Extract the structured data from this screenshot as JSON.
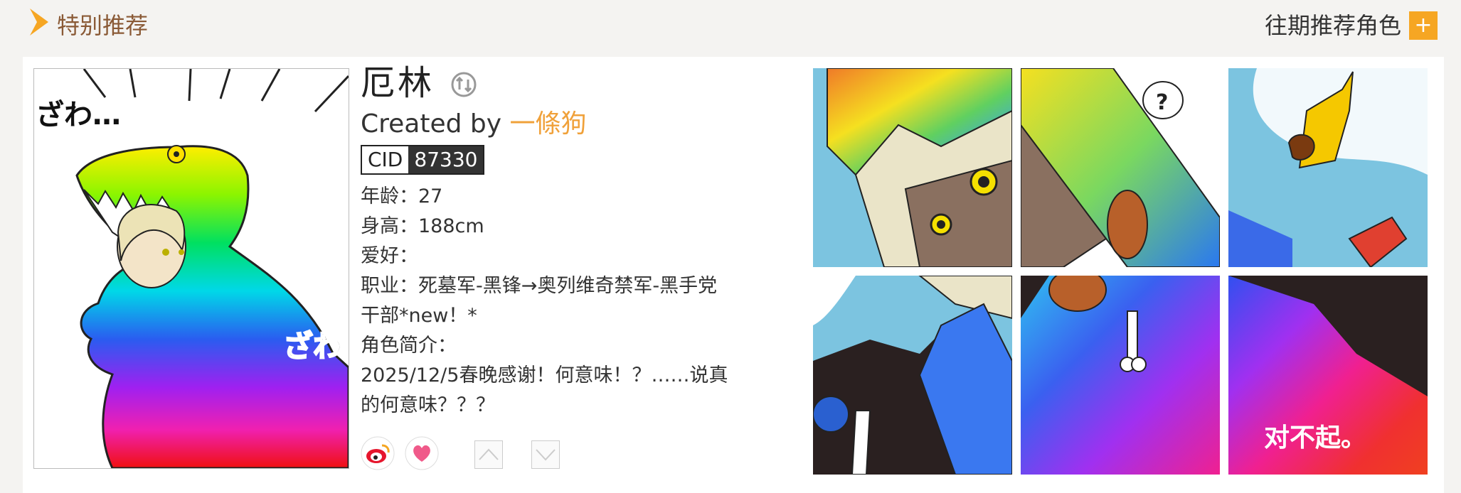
{
  "header": {
    "title": "特别推荐",
    "history_link": "往期推荐角色",
    "plus_label": "+"
  },
  "character": {
    "name": "厄林",
    "created_by_label": "Created by",
    "creator": "一條狗",
    "cid_label": "CID",
    "cid": "87330",
    "fields": [
      "年龄：27",
      "身高：188cm",
      "爱好：",
      "职业：死墓军-黑锋→奥列维奇禁军-黑手党干部*new！*",
      "角色简介：",
      "2025/12/5春晚感谢！何意味！？……说真的何意味？？？"
    ]
  },
  "portrait": {
    "sfx_top": "ざわ…",
    "sfx_right": "ざわ"
  },
  "gallery": {
    "caption_text": "对不起。"
  },
  "icons": {
    "header": "chevron-right-icon",
    "switch": "swap-icon",
    "weibo": "weibo-icon",
    "like": "heart-icon",
    "up": "arrow-up-image-icon",
    "down": "arrow-down-image-icon"
  },
  "colors": {
    "accent": "#f6a623",
    "header_title": "#8a5a36",
    "creator": "#f0a13a",
    "background": "#f4f3f1"
  }
}
